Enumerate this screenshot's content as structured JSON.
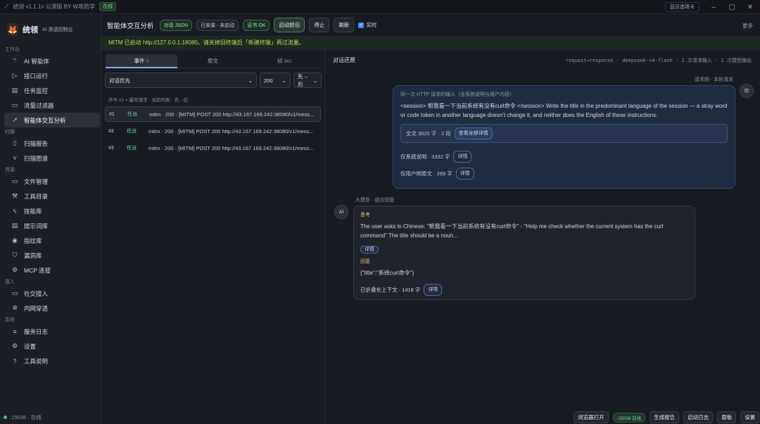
{
  "titlebar": {
    "app_title": "统领 v1.1.1v 公测版 BY W攻防学",
    "status": "在线",
    "shortcut": "显示选项卡"
  },
  "sidebar": {
    "brand_name": "统领",
    "brand_sub": "AI 渗透控制台",
    "groups": [
      {
        "label": "工作台",
        "items": [
          {
            "label": "AI 智能体"
          },
          {
            "label": "接口运行"
          },
          {
            "label": "任务监控"
          },
          {
            "label": "流量过滤器"
          },
          {
            "label": "智能体交互分析"
          }
        ]
      },
      {
        "label": "扫描",
        "items": [
          {
            "label": "扫描报告"
          },
          {
            "label": "扫描图谱"
          }
        ]
      },
      {
        "label": "资源",
        "items": [
          {
            "label": "文件管理"
          },
          {
            "label": "工具目录"
          },
          {
            "label": "技能库"
          },
          {
            "label": "提示词库"
          },
          {
            "label": "指纹库"
          },
          {
            "label": "漏洞库"
          },
          {
            "label": "MCP 连接"
          }
        ]
      },
      {
        "label": "接入",
        "items": [
          {
            "label": "社交接入"
          },
          {
            "label": "内网穿透"
          }
        ]
      },
      {
        "label": "系统",
        "items": [
          {
            "label": "服务日志"
          },
          {
            "label": "设置"
          },
          {
            "label": "工具说明"
          }
        ]
      }
    ],
    "footer_status": ":15038 · 在线"
  },
  "header": {
    "title": "智能体交互分析",
    "pill_format": "对话 JSON",
    "pill_install": "已安装 · 未启动",
    "pill_cert": "证书 OK",
    "btn_start": "启动抓包",
    "btn_stop": "停止",
    "btn_refresh": "刷新",
    "realtime_label": "实时",
    "more": "更多"
  },
  "banner": {
    "text": "MITM 已启动 http://127.0.0.1:18080。请关掉旧终端后「新建终端」再过流量。"
  },
  "left": {
    "tabs": [
      {
        "label": "事件",
        "count": "3"
      },
      {
        "label": "原文",
        "count": ""
      },
      {
        "label": "帧",
        "count": "362"
      }
    ],
    "filter_mode": "对话优先",
    "filter_status": "200",
    "filter_order": "先→后",
    "hint": "序号 #1 = 最早请求 · 当前列表：先→后",
    "events": [
      {
        "num": "#1",
        "tag": "任派",
        "text": "mitm · 200 · [MITM] POST 200 http://43.167.169.242:38080/v1/mess..."
      },
      {
        "num": "#2",
        "tag": "任派",
        "text": "mitm · 200 · [MITM] POST 200 http://43.167.169.242:38080/v1/mess..."
      },
      {
        "num": "#3",
        "tag": "任派",
        "text": "mitm · 200 · [MITM] POST 200 http://43.167.169.242:38080/v1/mess..."
      }
    ]
  },
  "right": {
    "title": "对话还原",
    "meta": "request→response · deepseek-v4-flash · 1 次请求输入 · 1 次模型输出",
    "request_label": "请求侧 · 本轮请求",
    "user_avatar": "你",
    "req_title": "同一次 HTTP 请求的输入（含系统说明与用户内容）",
    "req_body": "<session> 帮我看一下当前系统有没有curl命令 </session> Write the title in the predominant language of the session — a stray word or code token in another language doesn't change it, and neither does the English of these instructions.",
    "full_text": "全文 3625 字 · 2 段",
    "full_btn": "查看全部详情",
    "sys_line": "仅系统说明 · 3332 字",
    "user_line": "仅用户侧原文 · 269 字",
    "detail_btn": "详情",
    "ai_avatar": "AI",
    "response_label": "大模型 · 组合回复",
    "think_title": "思考",
    "think_body": "The user asks in Chinese: \"帮我看一下当前系统有没有curl命令\" - \"Help me check whether the current system has the curl command\" The title should be a noun...",
    "answer_title": "回复",
    "answer_body": "{\"title\":\"系统curl命令\"}",
    "folded_line": "已折叠长上下文 · 1418 字"
  },
  "bottombar": {
    "open_browser": "浏览器打开",
    "port": ":15038 在线",
    "report": "生成报告",
    "log": "启动日志",
    "panel": "面板",
    "settings": "设置"
  }
}
